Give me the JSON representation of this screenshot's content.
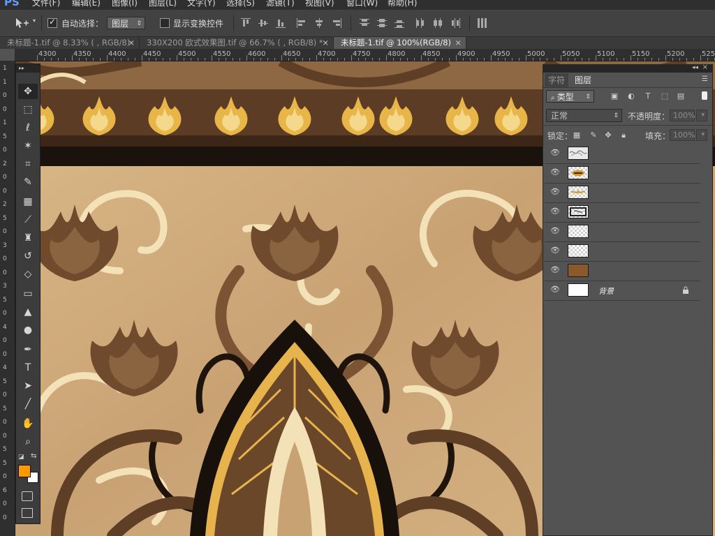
{
  "app": {
    "logo": "PS"
  },
  "menu": [
    "文件(F)",
    "编辑(E)",
    "图像(I)",
    "图层(L)",
    "文字(Y)",
    "选择(S)",
    "滤镜(T)",
    "视图(V)",
    "窗口(W)",
    "帮助(H)"
  ],
  "options": {
    "auto_select_label": "自动选择：",
    "auto_select_checked": true,
    "auto_select_value": "图层",
    "show_transform_label": "显示变换控件",
    "show_transform_checked": false
  },
  "tabs": [
    {
      "label": "未标题-1.tif @ 8.33% ( , RGB/8)",
      "active": false
    },
    {
      "label": "330X200 欧式效果图.tif @ 66.7% ( , RGB/8) *",
      "active": false
    },
    {
      "label": "未标题-1.tif @ 100%(RGB/8)",
      "active": true
    }
  ],
  "ruler_top": [
    "4300",
    "4350",
    "4400",
    "4450",
    "4500",
    "4550",
    "4600",
    "4650",
    "4700",
    "4750",
    "4800",
    "4850",
    "4900",
    "4950",
    "5000",
    "5050",
    "5100",
    "5150",
    "5200",
    "525"
  ],
  "ruler_left": [
    "1",
    "1",
    "0",
    "0",
    "1",
    "5",
    "0",
    "2",
    "0",
    "0",
    "2",
    "5",
    "0",
    "3",
    "0",
    "0",
    "3",
    "5",
    "0",
    "4",
    "0",
    "0",
    "4",
    "5",
    "0",
    "5",
    "0",
    "0",
    "5",
    "5",
    "0",
    "6",
    "0",
    "0"
  ],
  "colors": {
    "foreground": "#ff9900",
    "background": "#ffffff",
    "canvas_bg": "#d2ae80"
  },
  "toolbox": [
    "move-icon",
    "rect-marquee-icon",
    "lasso-icon",
    "magic-wand-icon",
    "crop-icon",
    "eyedropper-icon",
    "healing-brush-icon",
    "brush-icon",
    "clone-stamp-icon",
    "history-brush-icon",
    "eraser-icon",
    "gradient-icon",
    "blur-icon",
    "dodge-icon",
    "pen-icon",
    "type-icon",
    "path-selection-icon",
    "line-icon",
    "hand-icon",
    "zoom-icon"
  ],
  "layers_panel": {
    "tabs": [
      "字符",
      "图层"
    ],
    "kind_filter": "类型",
    "blend_mode": "正常",
    "opacity_label": "不透明度：",
    "opacity_value": "100%",
    "lock_label": "锁定：",
    "fill_label": "填充：",
    "fill_value": "100%",
    "layers": [
      {
        "name": "",
        "thumb": "marble"
      },
      {
        "name": "",
        "thumb": "ornament-gold"
      },
      {
        "name": "",
        "thumb": "ornament-dark"
      },
      {
        "name": "",
        "thumb": "ornament-border"
      },
      {
        "name": "",
        "thumb": "transparent"
      },
      {
        "name": "",
        "thumb": "transparent"
      },
      {
        "name": "",
        "thumb": "brown"
      },
      {
        "name": "背景",
        "thumb": "white",
        "locked": true
      }
    ]
  }
}
